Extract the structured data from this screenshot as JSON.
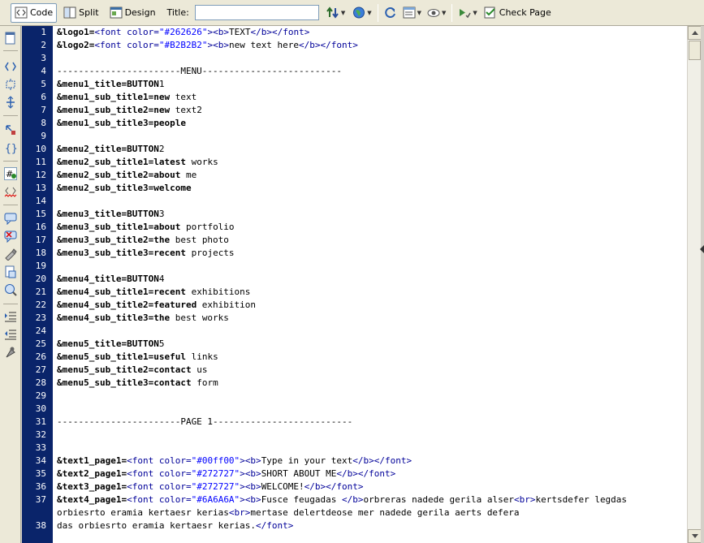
{
  "toolbar": {
    "code_label": "Code",
    "split_label": "Split",
    "design_label": "Design",
    "title_label": "Title:",
    "title_value": "",
    "check_page_label": "Check Page"
  },
  "editor": {
    "lines": [
      {
        "n": "1",
        "t": "&logo1=<font color=\"#262626\"><b>TEXT</b></font>"
      },
      {
        "n": "2",
        "t": "&logo2=<font color=\"#B2B2B2\"><b>new text here</b></font>"
      },
      {
        "n": "3",
        "t": ""
      },
      {
        "n": "4",
        "t": "-----------------------MENU--------------------------"
      },
      {
        "n": "5",
        "t": "&menu1_title=BUTTON1"
      },
      {
        "n": "6",
        "t": "&menu1_sub_title1=new text"
      },
      {
        "n": "7",
        "t": "&menu1_sub_title2=new text2"
      },
      {
        "n": "8",
        "t": "&menu1_sub_title3=people"
      },
      {
        "n": "9",
        "t": ""
      },
      {
        "n": "10",
        "t": "&menu2_title=BUTTON2"
      },
      {
        "n": "11",
        "t": "&menu2_sub_title1=latest works"
      },
      {
        "n": "12",
        "t": "&menu2_sub_title2=about me"
      },
      {
        "n": "13",
        "t": "&menu2_sub_title3=welcome"
      },
      {
        "n": "14",
        "t": ""
      },
      {
        "n": "15",
        "t": "&menu3_title=BUTTON3"
      },
      {
        "n": "16",
        "t": "&menu3_sub_title1=about portfolio"
      },
      {
        "n": "17",
        "t": "&menu3_sub_title2=the best photo"
      },
      {
        "n": "18",
        "t": "&menu3_sub_title3=recent projects"
      },
      {
        "n": "19",
        "t": ""
      },
      {
        "n": "20",
        "t": "&menu4_title=BUTTON4"
      },
      {
        "n": "21",
        "t": "&menu4_sub_title1=recent exhibitions"
      },
      {
        "n": "22",
        "t": "&menu4_sub_title2=featured exhibition"
      },
      {
        "n": "23",
        "t": "&menu4_sub_title3=the best works"
      },
      {
        "n": "24",
        "t": ""
      },
      {
        "n": "25",
        "t": "&menu5_title=BUTTON5"
      },
      {
        "n": "26",
        "t": "&menu5_sub_title1=useful links"
      },
      {
        "n": "27",
        "t": "&menu5_sub_title2=contact us"
      },
      {
        "n": "28",
        "t": "&menu5_sub_title3=contact form"
      },
      {
        "n": "29",
        "t": ""
      },
      {
        "n": "30",
        "t": ""
      },
      {
        "n": "31",
        "t": "-----------------------PAGE 1--------------------------"
      },
      {
        "n": "32",
        "t": ""
      },
      {
        "n": "33",
        "t": ""
      },
      {
        "n": "34",
        "t": "&text1_page1=<font color=\"#00ff00\"><b>Type in your text</b></font>"
      },
      {
        "n": "35",
        "t": "&text2_page1=<font color=\"#272727\"><b>SHORT ABOUT ME</b></font>"
      },
      {
        "n": "36",
        "t": "&text3_page1=<font color=\"#272727\"><b>WELCOME!</b></font>"
      },
      {
        "n": "37",
        "t": "&text4_page1=<font color=\"#6A6A6A\"><b>Fusce feugadas </b>orbreras nadede gerila alser<br>kertsdefer legdas"
      },
      {
        "n": "",
        "t": "orbiesrto eramia kertaesr kerias<br>mertase delertdeose mer nadede gerila aerts defera"
      },
      {
        "n": "38",
        "t": "das orbiesrto eramia kertaesr kerias.</font>"
      }
    ]
  },
  "colors": {
    "gutter_bg": "#0a246a",
    "tag_color": "#000099",
    "string_color": "#0000ff"
  }
}
